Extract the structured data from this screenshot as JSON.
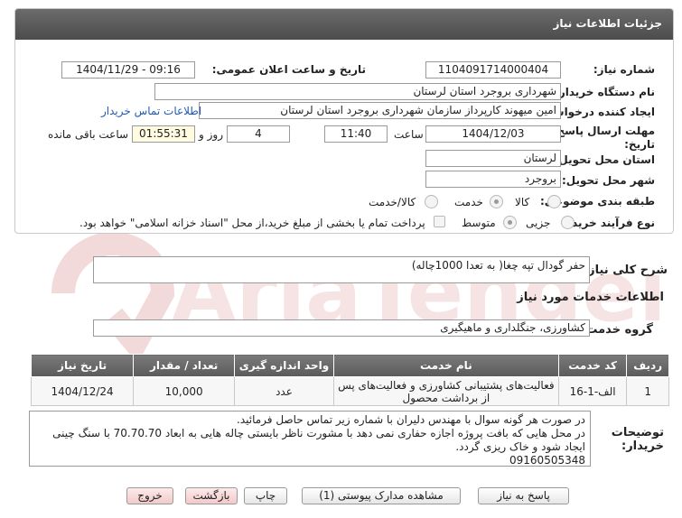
{
  "header": {
    "title": "جزئیات اطلاعات نیاز"
  },
  "fields": {
    "need_number_label": "شماره نیاز:",
    "need_number": "1104091714000404",
    "announce_label": "تاریخ و ساعت اعلان عمومی:",
    "announce_value": "1404/11/29 - 09:16",
    "buyer_label": "نام دستگاه خریدار:",
    "buyer_value": "شهرداری بروجرد استان لرستان",
    "creator_label": "ایجاد کننده درخواست:",
    "creator_value": "امین میهوند کارپرداز سازمان شهرداری بروجرد استان لرستان",
    "contact_link": "اطلاعات تماس خریدار",
    "deadline_label_1": "مهلت ارسال پاسخ: تا",
    "deadline_label_2": "تاریخ:",
    "deadline_date": "1404/12/03",
    "time_label": "ساعت",
    "deadline_time": "11:40",
    "days_value": "4",
    "days_label": "روز و",
    "remaining_time": "01:55:31",
    "remaining_label": "ساعت باقی مانده",
    "province_label": "استان محل تحویل:",
    "province_value": "لرستان",
    "city_label": "شهر محل تحویل:",
    "city_value": "بروجرد",
    "category_label": "طبقه بندی موضوعی:",
    "category_options": [
      "کالا",
      "خدمت",
      "کالا/خدمت"
    ],
    "category_selected": "خدمت",
    "process_label": "نوع فرآیند خرید :",
    "process_options": [
      "جزیی",
      "متوسط"
    ],
    "process_selected": "متوسط",
    "payment_note": "پرداخت تمام یا بخشی از مبلغ خرید،از محل \"اسناد خزانه اسلامی\" خواهد بود."
  },
  "summary": {
    "label": "شرح کلی نیاز:",
    "value": "حفر گودال تپه چغا( به تعدا 1000چاله)"
  },
  "services": {
    "section_title": "اطلاعات خدمات مورد نیاز",
    "group_label": "گروه خدمت:",
    "group_value": "کشاورزی، جنگلداری و ماهیگیری",
    "columns": [
      "ردیف",
      "کد خدمت",
      "نام خدمت",
      "واحد اندازه گیری",
      "تعداد / مقدار",
      "تاریخ نیاز"
    ],
    "rows": [
      [
        "1",
        "الف-1-16",
        "فعالیت‌های پشتیبانی کشاورزی و فعالیت‌های پس از برداشت محصول",
        "عدد",
        "10,000",
        "1404/12/24"
      ]
    ]
  },
  "buyer_notes": {
    "label_1": "توضیحات",
    "label_2": "خریدار:",
    "lines": [
      "در صورت هر گونه سوال با مهندس دلیران با شماره زیر تماس حاصل فرمائید.",
      "در محل هایی که بافت پروژه اجازه حفاری نمی دهد با مشورت ناظر بایستی چاله هایی به ابعاد 70.70.70 با سنگ چینی",
      "ایجاد شود و خاک ریزی گردد.",
      "09160505348"
    ]
  },
  "buttons": {
    "reply": "پاسخ به نیاز",
    "attachments": "مشاهده مدارک پیوستی (1)",
    "print": "چاپ",
    "back": "بازگشت",
    "exit": "خروج"
  },
  "colors": {
    "header_bg": "#5a5a5a",
    "link": "#1e5bb8",
    "watermark": "#f2dede",
    "exit_button": "#f3c9c9"
  }
}
